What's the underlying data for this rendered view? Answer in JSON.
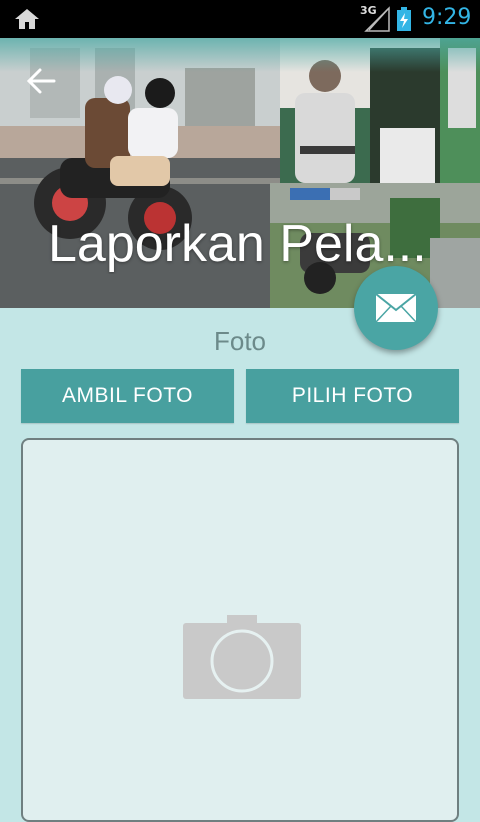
{
  "status_bar": {
    "network": "3G",
    "time": "9:29",
    "icons": [
      "home-icon",
      "signal-icon",
      "battery-charging-icon"
    ]
  },
  "header": {
    "title": "Laporkan Pela...",
    "back_icon": "arrow-left-icon",
    "fab_icon": "envelope-icon"
  },
  "photo_section": {
    "label": "Foto",
    "ambil_label": "AMBIL FOTO",
    "pilih_label": "PILIH FOTO",
    "placeholder_icon": "camera-icon"
  },
  "colors": {
    "accent": "#48a09f",
    "background": "#c3e6e6",
    "status_time": "#33b5e5",
    "frame_fill": "#e0efef"
  }
}
